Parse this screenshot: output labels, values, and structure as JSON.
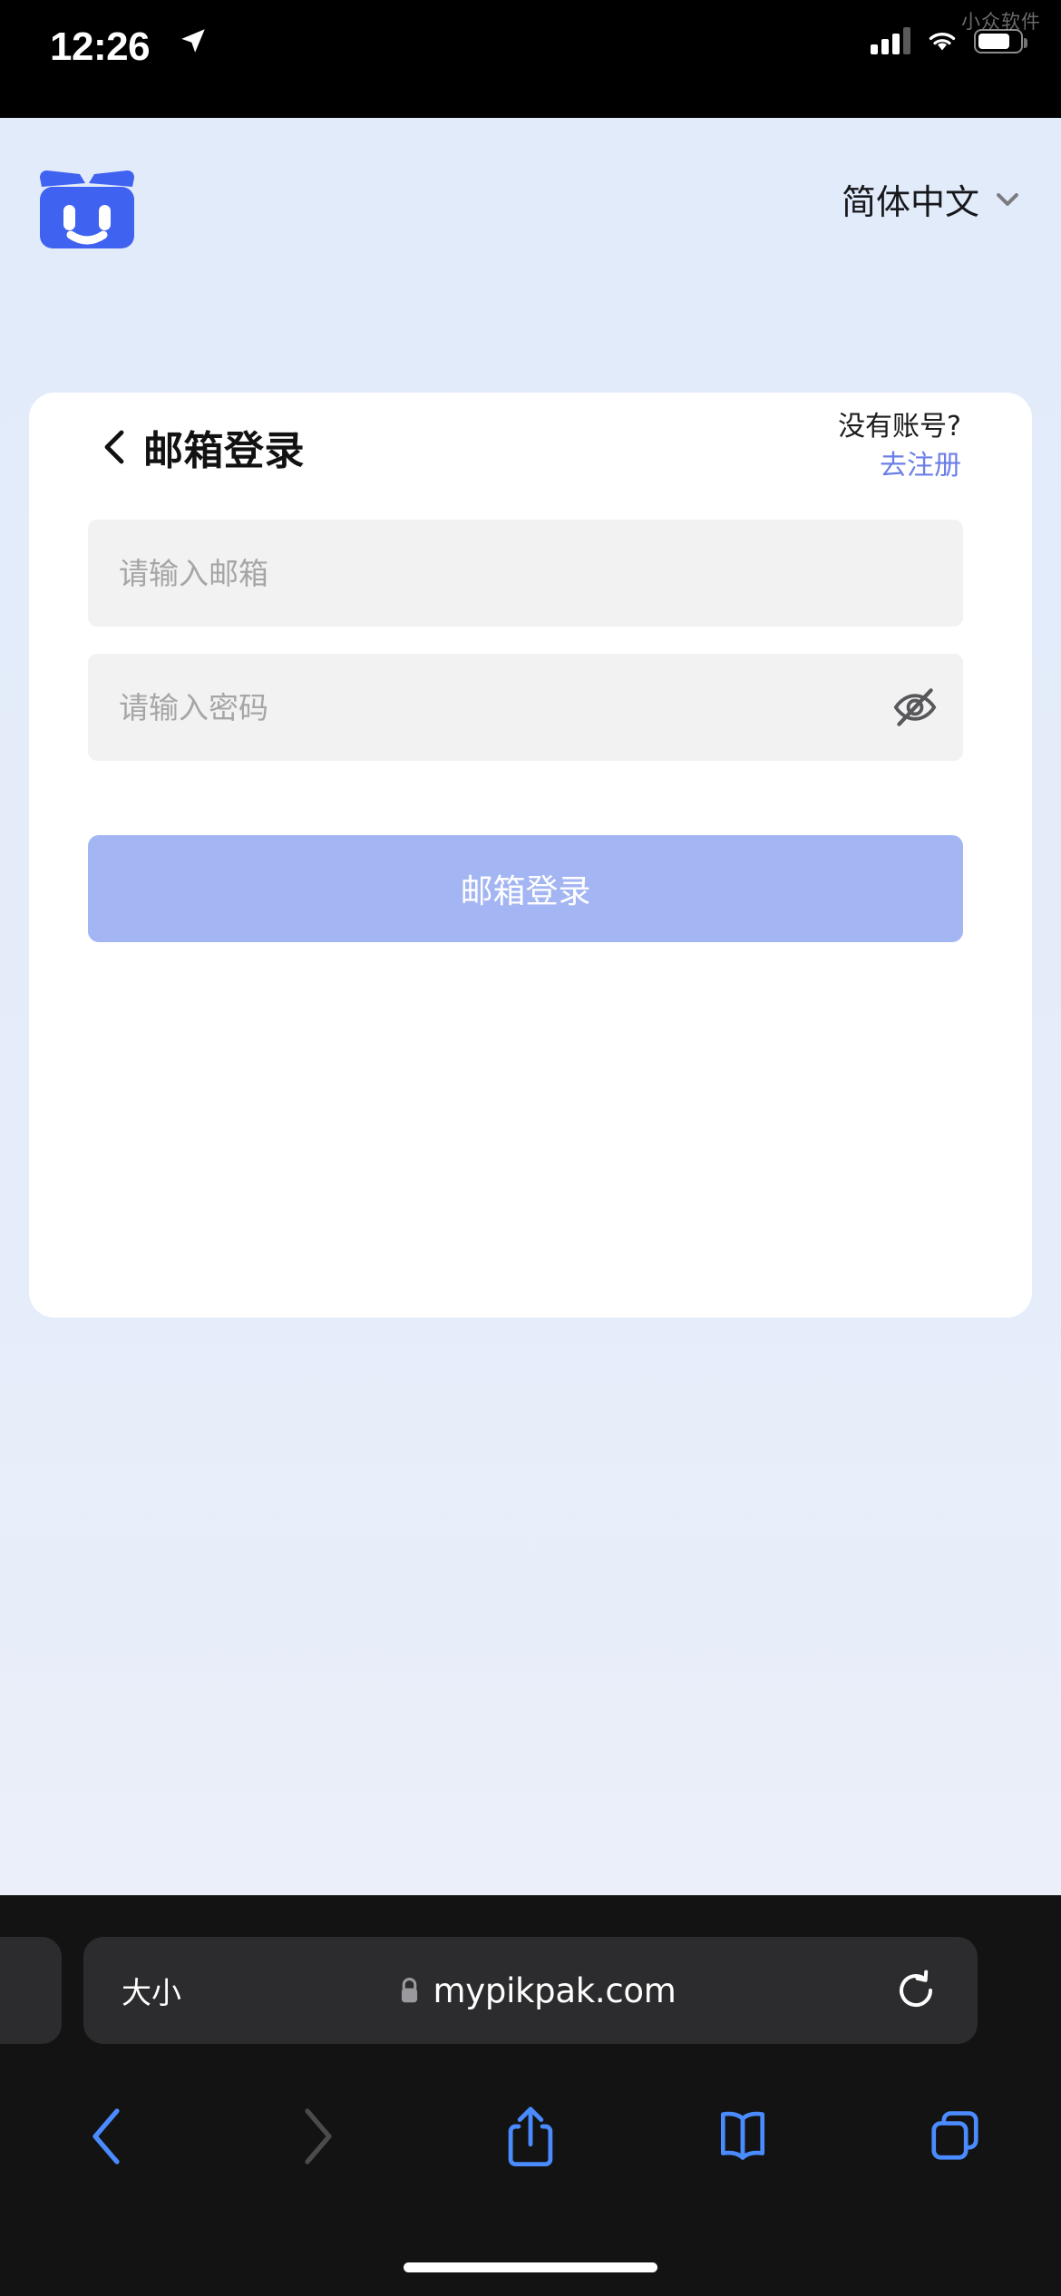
{
  "status_bar": {
    "time": "12:26",
    "location_icon": "location-arrow-icon",
    "cellular_icon": "cellular-bars-icon",
    "wifi_icon": "wifi-icon",
    "battery_icon": "battery-icon",
    "watermark": "小众软件"
  },
  "page": {
    "brand": {
      "logo_name": "pikpak-logo",
      "logo_color": "#3f62f0"
    },
    "language_selector": {
      "value": "简体中文",
      "chevron_icon": "chevron-down-icon"
    },
    "card": {
      "back_icon": "chevron-left-icon",
      "title": "邮箱登录",
      "signup_prompt": "没有账号?",
      "signup_link": "去注册",
      "email_field": {
        "placeholder": "请输入邮箱",
        "value": ""
      },
      "password_field": {
        "placeholder": "请输入密码",
        "value": "",
        "toggle_icon": "eye-off-icon"
      },
      "submit_label": "邮箱登录",
      "submit_color": "#a4b5f3"
    }
  },
  "browser": {
    "text_size_label": "大小",
    "lock_icon": "lock-icon",
    "url": "mypikpak.com",
    "reload_icon": "reload-icon",
    "toolbar": [
      {
        "name": "back-button",
        "icon": "chevron-left-icon",
        "enabled": true
      },
      {
        "name": "forward-button",
        "icon": "chevron-right-icon",
        "enabled": false
      },
      {
        "name": "share-button",
        "icon": "share-icon",
        "enabled": true
      },
      {
        "name": "bookmarks-button",
        "icon": "book-icon",
        "enabled": true
      },
      {
        "name": "tabs-button",
        "icon": "tabs-icon",
        "enabled": true
      }
    ],
    "accent_color": "#4a8cff"
  }
}
